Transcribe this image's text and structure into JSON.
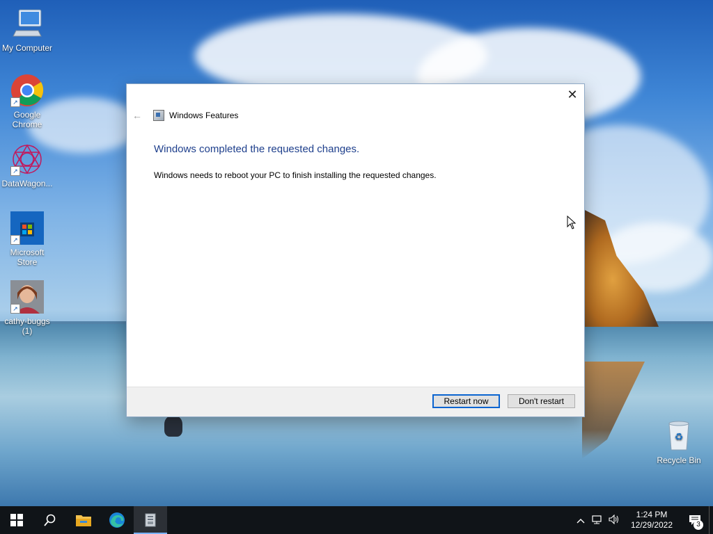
{
  "desktop": {
    "icons": [
      {
        "label": "My Computer"
      },
      {
        "label": "Google Chrome"
      },
      {
        "label": "DataWagon..."
      },
      {
        "label": "Microsoft Store"
      },
      {
        "label": "cathy-buggs (1)"
      },
      {
        "label": "Recycle Bin"
      }
    ]
  },
  "dialog": {
    "header_title": "Windows Features",
    "close_glyph": "✕",
    "back_glyph": "←",
    "heading": "Windows completed the requested changes.",
    "message": "Windows needs to reboot your PC to finish installing the requested changes.",
    "restart_label": "Restart now",
    "dont_restart_label": "Don't restart"
  },
  "taskbar": {
    "clock_time": "1:24 PM",
    "clock_date": "12/29/2022",
    "notification_count": "3"
  },
  "colors": {
    "accent": "#0a64d0",
    "heading": "#1e3f8c",
    "taskbar": "#101418"
  }
}
